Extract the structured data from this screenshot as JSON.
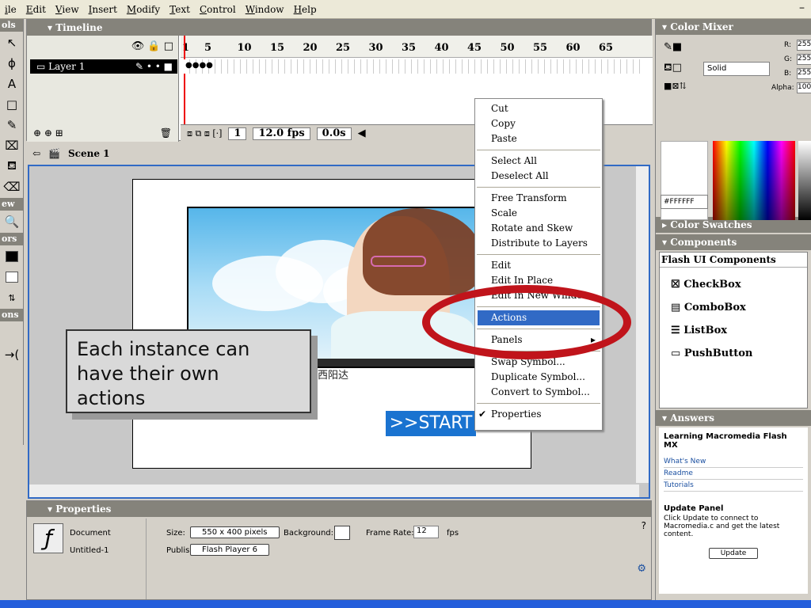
{
  "menubar": [
    "ile",
    "Edit",
    "View",
    "Insert",
    "Modify",
    "Text",
    "Control",
    "Window",
    "Help"
  ],
  "window_min": "–",
  "tools_panel": {
    "title": "ols",
    "view_label": "ew",
    "colors_label": "ors",
    "options_label": "ons"
  },
  "timeline": {
    "title": "Timeline",
    "layer_name": "Layer 1",
    "ruler": [
      "1",
      "5",
      "10",
      "15",
      "20",
      "25",
      "30",
      "35",
      "40",
      "45",
      "50",
      "55",
      "60",
      "65"
    ],
    "current_frame": "1",
    "fps": "12.0 fps",
    "elapsed": "0.0s"
  },
  "scene": {
    "label": "Scene 1"
  },
  "callout": {
    "lines": [
      "Each instance can",
      "have their own",
      "actions"
    ]
  },
  "start_button": {
    "label": ">>START"
  },
  "anim_caption": "于西阳达",
  "context_menu": {
    "groups": [
      [
        "Cut",
        "Copy",
        "Paste"
      ],
      [
        "Select All",
        "Deselect All"
      ],
      [
        "Free Transform",
        "Scale",
        "Rotate and Skew",
        "Distribute to Layers"
      ],
      [
        "Edit",
        "Edit In Place",
        "Edit In New Window"
      ],
      [
        "Actions"
      ],
      [
        "Panels"
      ],
      [
        "Swap Symbol...",
        "Duplicate Symbol...",
        "Convert to Symbol..."
      ],
      [
        "Properties"
      ]
    ],
    "highlighted": "Actions"
  },
  "color_mixer": {
    "title": "Color Mixer",
    "fill_style": "Solid",
    "r": "255",
    "g": "255",
    "b": "255",
    "r_label": "R:",
    "g_label": "G:",
    "b_label": "B:",
    "alpha_label": "Alpha:",
    "alpha": "100",
    "hex": "#FFFFFF"
  },
  "color_swatches": {
    "title": "Color Swatches"
  },
  "components": {
    "title": "Components",
    "group": "Flash UI Components",
    "items": [
      "CheckBox",
      "ComboBox",
      "ListBox",
      "PushButton"
    ]
  },
  "answers": {
    "title": "Answers",
    "heading": "Learning Macromedia Flash MX",
    "links": [
      "What's New",
      "Readme",
      "Tutorials"
    ],
    "update_title": "Update Panel",
    "update_text": "Click Update to connect to Macromedia.c and get the latest content.",
    "update_button": "Update"
  },
  "properties": {
    "title": "Properties",
    "doc_type": "Document",
    "doc_name": "Untitled-1",
    "size_label": "Size:",
    "size_value": "550 x 400 pixels",
    "bg_label": "Background:",
    "rate_label": "Frame Rate:",
    "rate_value": "12",
    "fps_unit": "fps",
    "publish_label": "Publish:",
    "publish_value": "Flash Player 6"
  },
  "colors": {
    "accent": "#316ac5",
    "highlight_ellipse": "#c0141b",
    "start_button": "#1a73d0"
  }
}
